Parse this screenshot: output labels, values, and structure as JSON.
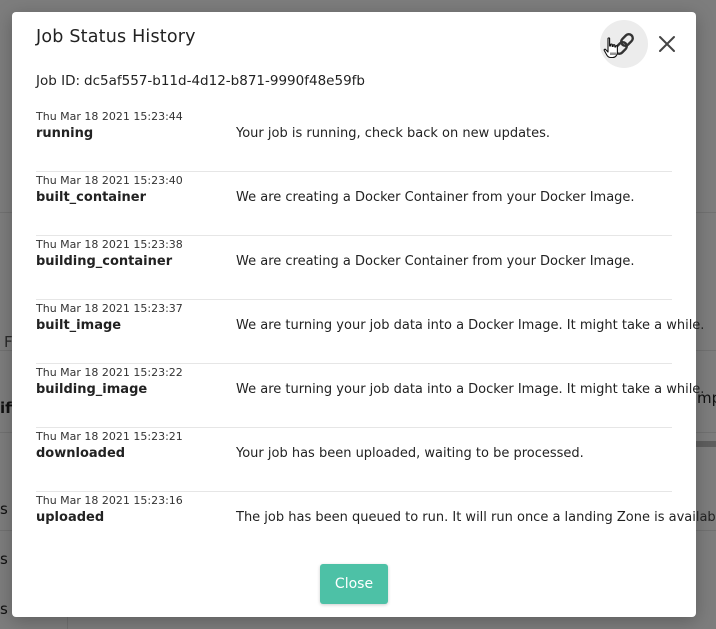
{
  "background": {
    "fragments": [
      "F",
      "ifi",
      "mp",
      "s a",
      "s a",
      "s a"
    ]
  },
  "modal": {
    "title": "Job Status History",
    "link_icon": "link-icon",
    "close_icon": "close-icon",
    "job_id_label": "Job ID:",
    "job_id_value": "dc5af557-b11d-4d12-b871-9990f48e59fb",
    "statuses": [
      {
        "time": "Thu Mar 18 2021 15:23:44",
        "name": "running",
        "message": "Your job is running, check back on new updates."
      },
      {
        "time": "Thu Mar 18 2021 15:23:40",
        "name": "built_container",
        "message": "We are creating a Docker Container from your Docker Image."
      },
      {
        "time": "Thu Mar 18 2021 15:23:38",
        "name": "building_container",
        "message": "We are creating a Docker Container from your Docker Image."
      },
      {
        "time": "Thu Mar 18 2021 15:23:37",
        "name": "built_image",
        "message": "We are turning your job data into a Docker Image. It might take a while."
      },
      {
        "time": "Thu Mar 18 2021 15:23:22",
        "name": "building_image",
        "message": "We are turning your job data into a Docker Image. It might take a while."
      },
      {
        "time": "Thu Mar 18 2021 15:23:21",
        "name": "downloaded",
        "message": "Your job has been uploaded, waiting to be processed."
      },
      {
        "time": "Thu Mar 18 2021 15:23:16",
        "name": "uploaded",
        "message": "The job has been queued to run. It will run once a landing Zone is available."
      }
    ],
    "close_label": "Close",
    "accent_color": "#4dc1a6"
  }
}
